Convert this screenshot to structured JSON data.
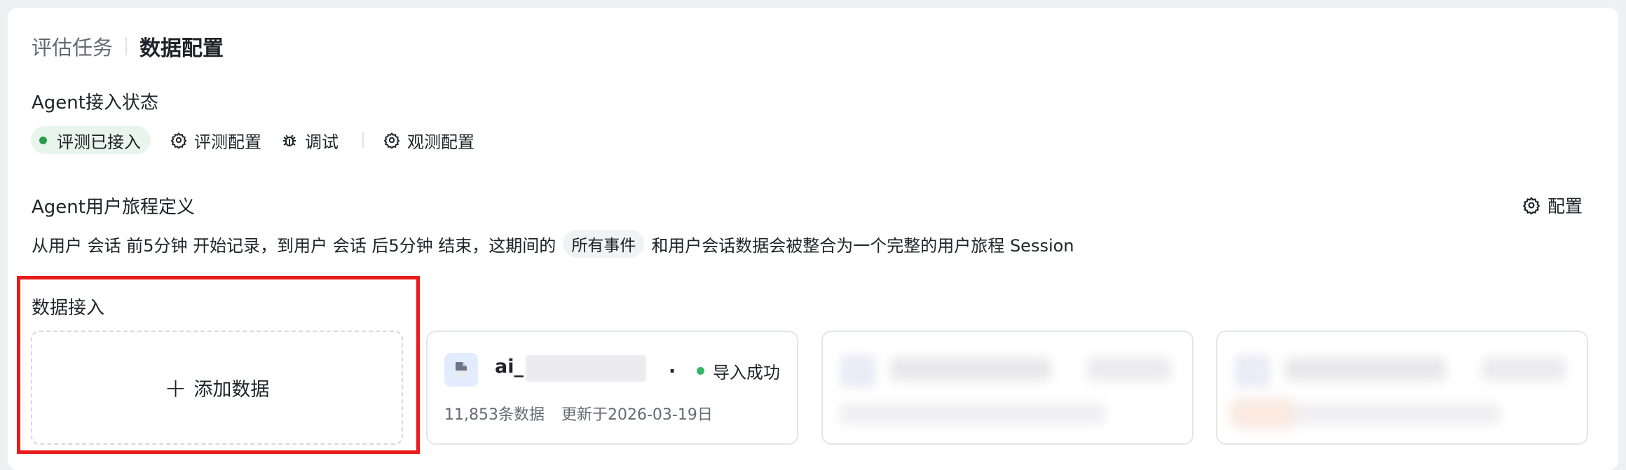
{
  "breadcrumb": {
    "parent": "评估任务",
    "current": "数据配置"
  },
  "agent_status": {
    "title": "Agent接入状态",
    "badge": "评测已接入",
    "actions": {
      "eval_config": "评测配置",
      "debug": "调试",
      "observe_config": "观测配置"
    }
  },
  "journey": {
    "title": "Agent用户旅程定义",
    "config_label": "配置",
    "desc_prefix": "从用户 会话 前5分钟 开始记录，到用户 会话 后5分钟 结束，这期间的",
    "event_chip": "所有事件",
    "desc_suffix": "和用户会话数据会被整合为一个完整的用户旅程 Session"
  },
  "data_intake": {
    "title": "数据接入",
    "add_label": "添加数据",
    "cards": [
      {
        "name": "ai_",
        "name_tail": ".",
        "status": "导入成功",
        "count": "11,853条数据",
        "updated": "更新于2026-03-19日"
      }
    ]
  },
  "colors": {
    "success": "#34b36a",
    "badge_bg": "#e8f5ec",
    "highlight": "#ea1a1a",
    "file_icon_bg": "#e3ecff"
  },
  "icons": {
    "gear": "gear-icon",
    "bug": "bug-icon",
    "plus": "plus-icon",
    "file": "file-icon"
  }
}
